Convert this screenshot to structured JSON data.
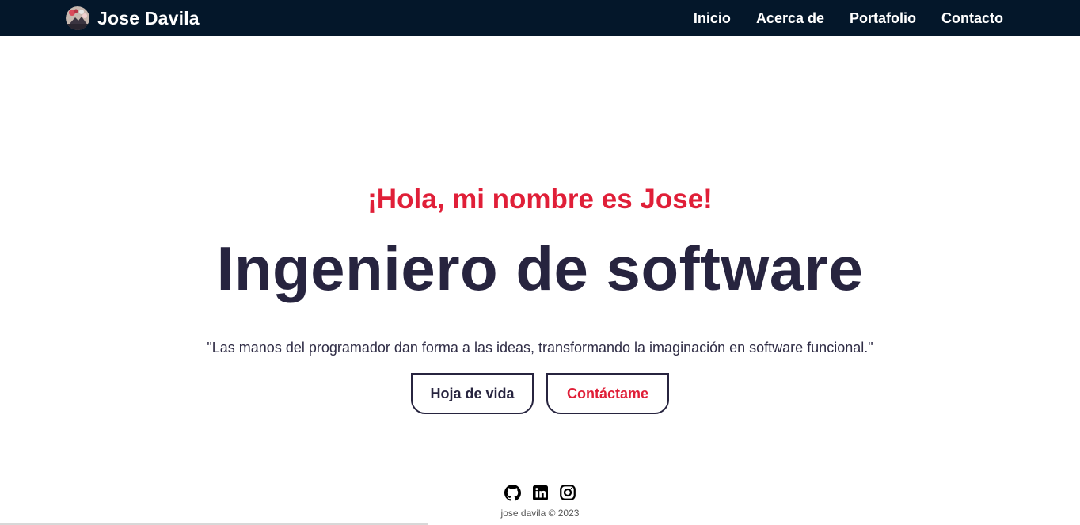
{
  "navbar": {
    "brand_name": "Jose Davila",
    "links": [
      {
        "label": "Inicio"
      },
      {
        "label": "Acerca de"
      },
      {
        "label": "Portafolio"
      },
      {
        "label": "Contacto"
      }
    ],
    "background": "#04172a"
  },
  "hero": {
    "greeting": "¡Hola, mi nombre es Jose!",
    "headline": "Ingeniero de software",
    "quote": "\"Las manos del programador dan forma a las ideas, transformando la imaginación en software funcional.\"",
    "buttons": {
      "cv_label": "Hoja de vida",
      "contact_label": "Contáctame"
    }
  },
  "socials": [
    {
      "icon": "github-icon"
    },
    {
      "icon": "linkedin-icon"
    },
    {
      "icon": "instagram-icon"
    }
  ],
  "footer": {
    "text": "jose davila © 2023"
  },
  "colors": {
    "accent": "#e01f38",
    "primary_text": "#27243f",
    "navbar": "#04172a"
  }
}
